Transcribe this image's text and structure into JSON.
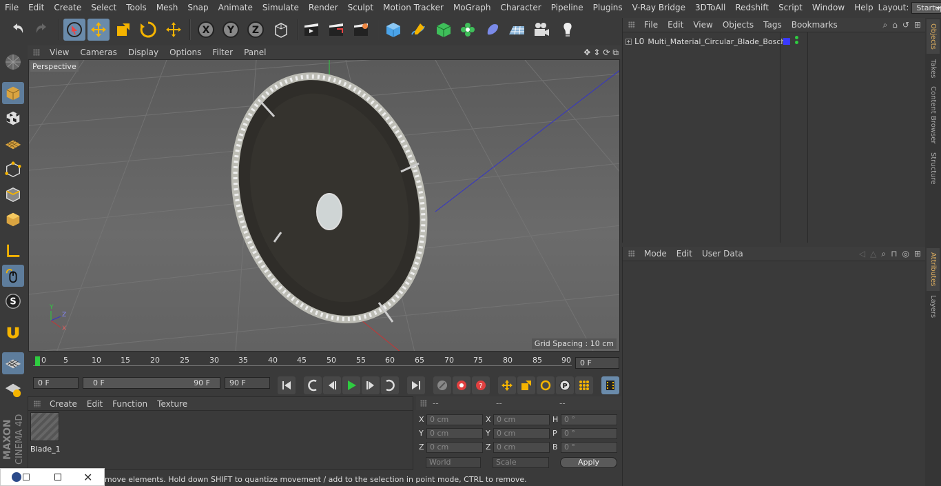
{
  "menubar": {
    "items": [
      "File",
      "Edit",
      "Create",
      "Select",
      "Tools",
      "Mesh",
      "Snap",
      "Animate",
      "Simulate",
      "Render",
      "Sculpt",
      "Motion Tracker",
      "MoGraph",
      "Character",
      "Pipeline",
      "Plugins",
      "V-Ray Bridge",
      "3DToAll",
      "Redshift",
      "Script",
      "Window",
      "Help"
    ],
    "layout_label": "Layout:",
    "layout_value": "Startup"
  },
  "viewport": {
    "menu": [
      "View",
      "Cameras",
      "Display",
      "Options",
      "Filter",
      "Panel"
    ],
    "camera_label": "Perspective",
    "grid_spacing": "Grid Spacing : 10 cm",
    "axis_labels": [
      "Y",
      "Z",
      "X"
    ]
  },
  "timeline": {
    "ticks": [
      "0",
      "5",
      "10",
      "15",
      "20",
      "25",
      "30",
      "35",
      "40",
      "45",
      "50",
      "55",
      "60",
      "65",
      "70",
      "75",
      "80",
      "85",
      "90"
    ],
    "current_frame": "0 F",
    "start_field": "0 F",
    "range_start": "0 F",
    "range_end": "90 F",
    "end_field": "90 F"
  },
  "materials": {
    "menu": [
      "Create",
      "Edit",
      "Function",
      "Texture"
    ],
    "items": [
      {
        "name": "Blade_1"
      }
    ]
  },
  "coords": {
    "headers": [
      "--",
      "--",
      "--"
    ],
    "rows": [
      {
        "l1": "X",
        "v1": "0 cm",
        "l2": "X",
        "v2": "0 cm",
        "l3": "H",
        "v3": "0 °"
      },
      {
        "l1": "Y",
        "v1": "0 cm",
        "l2": "Y",
        "v2": "0 cm",
        "l3": "P",
        "v3": "0 °"
      },
      {
        "l1": "Z",
        "v1": "0 cm",
        "l2": "Z",
        "v2": "0 cm",
        "l3": "B",
        "v3": "0 °"
      }
    ],
    "mode_world": "World",
    "mode_scale": "Scale",
    "apply": "Apply"
  },
  "status": {
    "text": "move elements. Hold down SHIFT to quantize movement / add to the selection in point mode, CTRL to remove."
  },
  "objects": {
    "menu": [
      "File",
      "Edit",
      "View",
      "Objects",
      "Tags",
      "Bookmarks"
    ],
    "items": [
      {
        "name": "Multi_Material_Circular_Blade_Bosch",
        "layer_color": "#3a3aff"
      }
    ]
  },
  "attributes": {
    "menu": [
      "Mode",
      "Edit",
      "User Data"
    ]
  },
  "right_tabs": [
    "Objects",
    "Takes",
    "Content Browser",
    "Structure",
    "Attributes",
    "Layers"
  ],
  "logo": {
    "brand": "MAXON",
    "product": "CINEMA 4D"
  },
  "colors": {
    "accent": "#6a8bab",
    "play": "#2ecc40",
    "record": "#e04040"
  }
}
